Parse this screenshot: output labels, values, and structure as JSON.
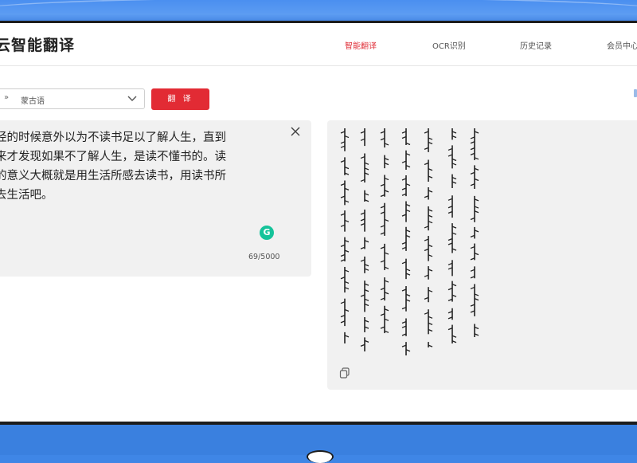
{
  "header": {
    "brand": "云智能翻译",
    "nav": [
      {
        "label": "智能翻译",
        "active": true
      },
      {
        "label": "OCR识别",
        "active": false
      },
      {
        "label": "历史记录",
        "active": false
      },
      {
        "label": "会员中心",
        "active": false
      }
    ]
  },
  "toolbar": {
    "target_language": "蒙古语",
    "language_arrows": "»",
    "translate_label": "翻 译"
  },
  "source": {
    "text": "经的时候意外以为不读书足以了解人生，直到\n来才发现如果不了解人生，是读不懂书的。读\n的意义大概就是用生活所感去读书，用读书所\n去生活吧。",
    "char_count": "69/5000",
    "grammar_badge": "G"
  },
  "output": {
    "script": "Mongolian vertical text"
  },
  "colors": {
    "accent": "#e22b34",
    "panel": "#f1f1f1",
    "grammarly": "#15c39a"
  },
  "icons": [
    "chevron-down-icon",
    "close-icon",
    "copy-icon",
    "grammar-icon"
  ]
}
